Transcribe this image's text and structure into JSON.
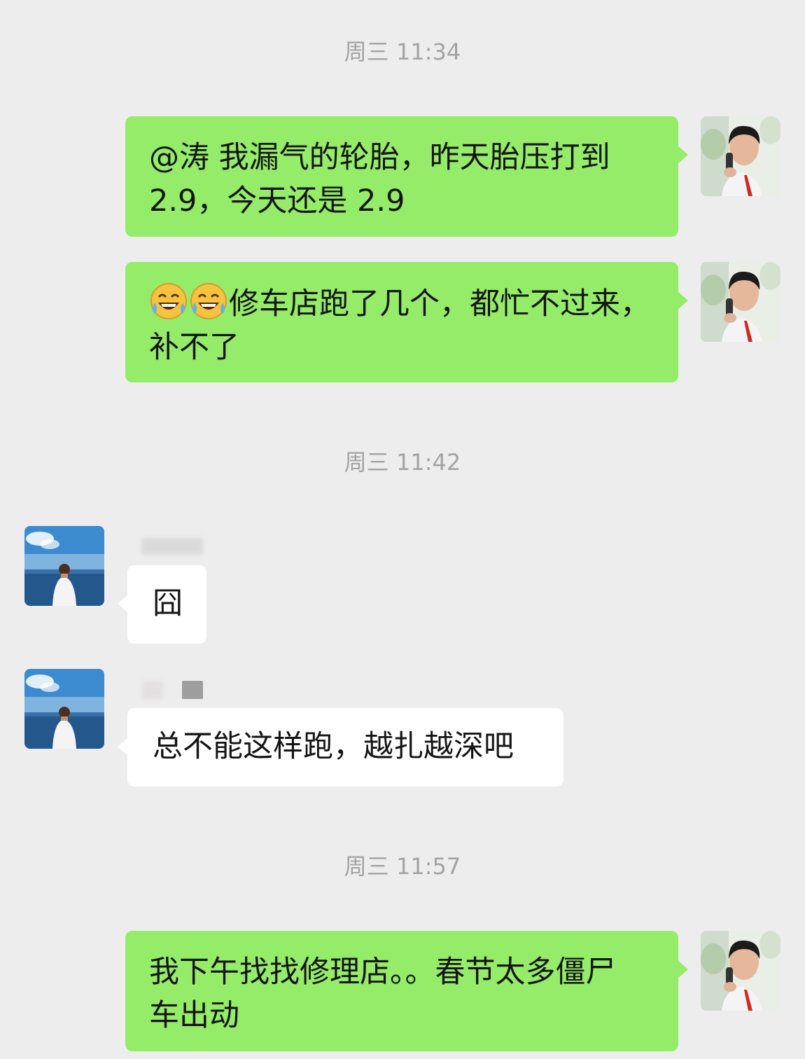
{
  "conversation": [
    {
      "type": "time",
      "text": "周三 11:34"
    },
    {
      "type": "message",
      "side": "out",
      "text_lines": [
        "@涛  我漏气的轮胎，昨天胎压打到",
        "2.9，今天还是 2.9"
      ]
    },
    {
      "type": "message",
      "side": "out",
      "emoji": [
        "face-with-tears-of-joy",
        "face-with-tears-of-joy"
      ],
      "text_lines": [
        "修车店跑了几个，都忙不过来，",
        "补不了"
      ]
    },
    {
      "type": "time",
      "text": "周三 11:42"
    },
    {
      "type": "message",
      "side": "in",
      "text": "囧"
    },
    {
      "type": "message",
      "side": "in",
      "text": "总不能这样跑，越扎越深吧"
    },
    {
      "type": "time",
      "text": "周三 11:57"
    },
    {
      "type": "message",
      "side": "out",
      "text_lines": [
        "我下午找找修理店。。春节太多僵尸",
        "车出动"
      ]
    }
  ],
  "colors": {
    "background": "#ededed",
    "outgoing_bubble": "#95ec69",
    "incoming_bubble": "#ffffff",
    "timestamp_text": "#a3a3a3"
  },
  "avatars": {
    "self": "avatar-man-on-phone-icon",
    "other": "avatar-man-by-sea-icon"
  }
}
